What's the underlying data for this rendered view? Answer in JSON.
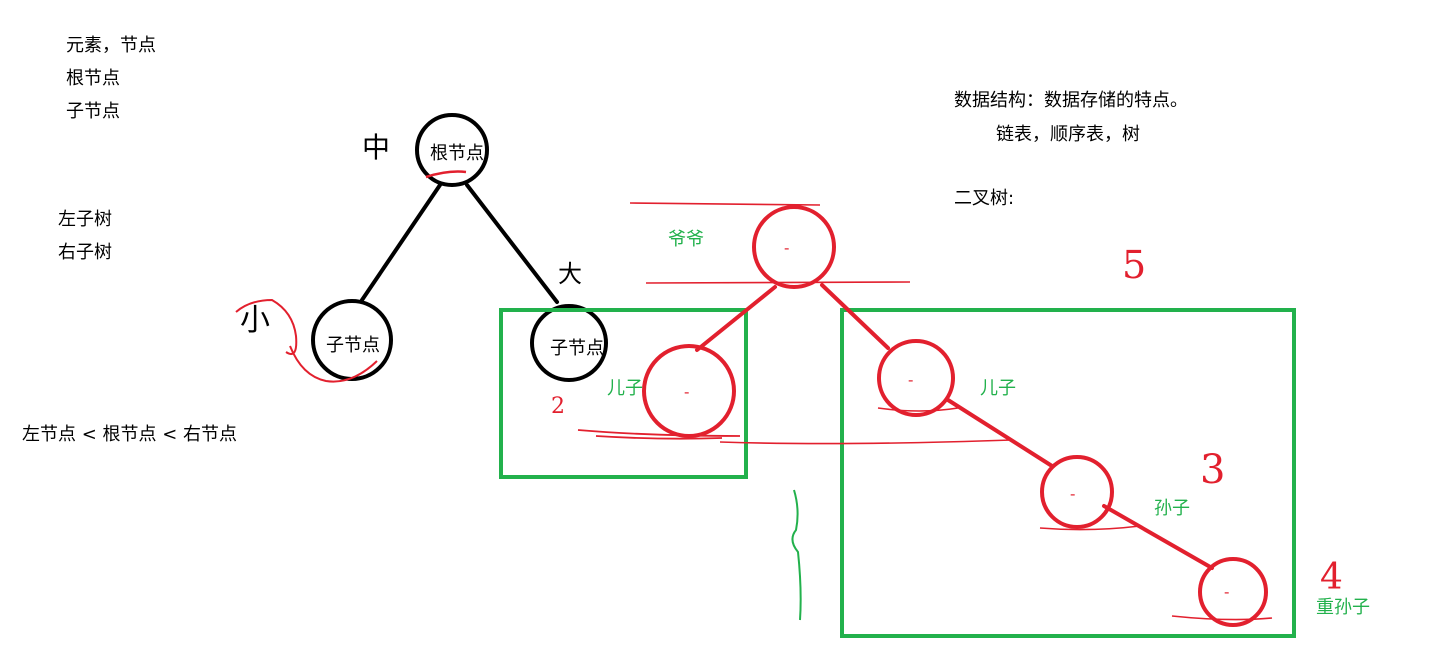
{
  "notes": {
    "line1": "元素，节点",
    "line2": "根节点",
    "line3": "子节点",
    "line4": "左子树",
    "line5": "右子树",
    "rule": "左节点  < 根节点 < 右节点",
    "ds_title": "数据结构：数据存储的特点。",
    "ds_examples": "链表，顺序表，树",
    "binary_tree": "二叉树:"
  },
  "black_tree": {
    "root": "根节点",
    "left": "子节点",
    "right": "子节点",
    "mark_root": "中",
    "mark_left": "小",
    "mark_right": "大"
  },
  "red_tree": {
    "grandpa": "爷爷",
    "son_left": "儿子",
    "son_right": "儿子",
    "grandson": "孙子",
    "great_grandson": "重孙子",
    "node_marks": [
      "-",
      "-",
      "-",
      "-",
      "-"
    ],
    "num_2": "2",
    "num_3": "3",
    "num_4": "4",
    "num_5": "5"
  },
  "colors": {
    "ink": "#000000",
    "red": "#e2202e",
    "green": "#22b14c"
  }
}
